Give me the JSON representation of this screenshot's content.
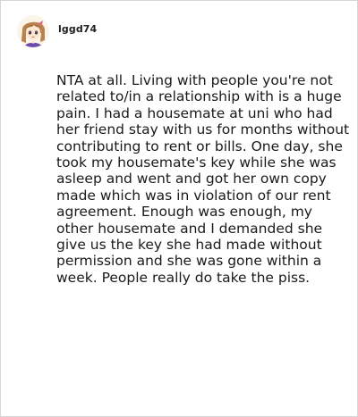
{
  "comment": {
    "author": {
      "username": "lggd74",
      "avatar_icon": "anime-character-avatar-icon"
    },
    "text": "NTA at all. Living with people you're not related to/in a relationship with is a huge pain. I had a housemate at uni who had her friend stay with us for months without contributing to rent or bills. One day, she took my housemate's key while she was asleep and went and got her own copy made which was in violation of our rent agreement. Enough was enough, my other housemate and I demanded she give us the key she had made without permission and she was gone within a week. People really do take the piss."
  },
  "colors": {
    "text": "#1a1a1a",
    "border": "#d6d6d6",
    "background": "#ffffff"
  }
}
